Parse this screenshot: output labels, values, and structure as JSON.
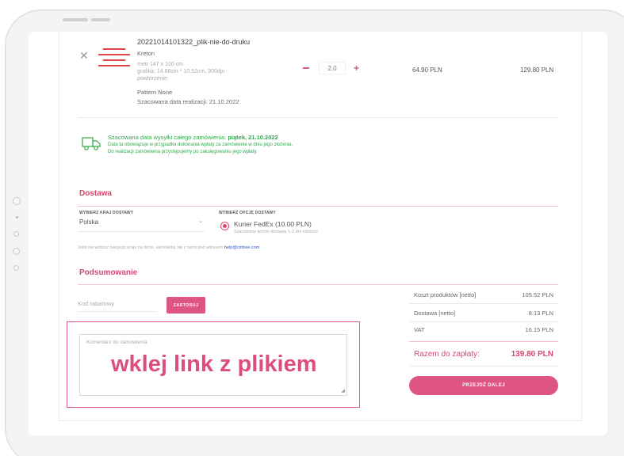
{
  "product": {
    "name": "20221014101322_plik-nie-do-druku",
    "material": "Kreton",
    "size": "metr 147 x 100 cm",
    "graphic": "grafika: 14.86cm * 10.52cm, 300dpi",
    "repeat_label": "powtórzenie:",
    "pattern": "Pattern None",
    "estimated_date": "Szacowana data realizacji: 21.10.2022",
    "quantity": "2.0",
    "unit_price": "64.90 PLN",
    "total_price": "129.80 PLN",
    "remove_glyph": "✕",
    "quantity_plus": "+"
  },
  "shipping_info": {
    "line1_prefix": "Szacowana data wysyłki całego zamówienia:",
    "line1_date": "piątek, 21.10.2022",
    "line2": "Data ta obowiązuje w przypadku dokonania wpłaty za zamówienie w dniu jego złożenia.",
    "line3": "Do realizacji zamówienia przystępujemy po zaksięgowaniu jego wpłaty."
  },
  "delivery": {
    "title": "Dostawa",
    "country_label": "WYBIERZ KRAJ DOSTAWY",
    "country_value": "Polska",
    "country_chevron": "⌄",
    "option_label": "WYBIERZ OPCJĘ DOSTAWY",
    "option_name": "Kurier FedEx (10.00 PLN)",
    "option_sub": "Szacowany termin dostawy 1-2 dni robocze",
    "contact_note": "Jeśli nie widzisz swojego kraju na liście, skontaktuj się z nami pod adresem",
    "contact_email": "help@ctnbee.com"
  },
  "summary": {
    "title": "Podsumowanie",
    "discount_placeholder": "Kod rabatowy",
    "apply_label": "ZASTOSUJ",
    "comment_placeholder": "Komentarz do zamówienia",
    "resize_glyph": "◢",
    "annotation": "wklej link z plikiem",
    "rows": [
      {
        "label": "Koszt produktów [netto]",
        "value": "105.52 PLN"
      },
      {
        "label": "Dostawa [netto]",
        "value": "8.13 PLN"
      },
      {
        "label": "VAT",
        "value": "16.15 PLN"
      }
    ],
    "total_label": "Razem do zapłaty:",
    "total_value": "139.80 PLN",
    "next_label": "PRZEJDŹ DALEJ"
  },
  "colors": {
    "accent": "#dd5580",
    "success": "#2eaa4a",
    "link": "#2e55c4"
  }
}
